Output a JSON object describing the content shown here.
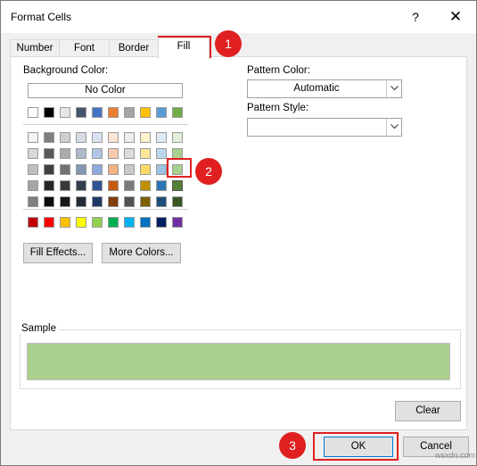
{
  "window": {
    "title": "Format Cells",
    "help_label": "?",
    "close_label": "✕"
  },
  "tabs": [
    {
      "label": "Number",
      "active": false
    },
    {
      "label": "Font",
      "active": false
    },
    {
      "label": "Border",
      "active": false
    },
    {
      "label": "Fill",
      "active": true
    }
  ],
  "background": {
    "label": "Background Color:",
    "no_color_label": "No Color",
    "top_row": [
      "#ffffff",
      "#000000",
      "#e7e6e6",
      "#44546a",
      "#4472c4",
      "#ed7d31",
      "#a5a5a5",
      "#ffc000",
      "#5b9bd5",
      "#70ad47"
    ],
    "theme_rows": [
      [
        "#f2f2f2",
        "#7f7f7f",
        "#d0cece",
        "#d6dce4",
        "#d9e2f3",
        "#fbe5d5",
        "#ededed",
        "#fff2cc",
        "#deebf6",
        "#e2efd9"
      ],
      [
        "#d8d8d8",
        "#595959",
        "#aeaaaa",
        "#adb9ca",
        "#b4c6e7",
        "#f7cbac",
        "#dbdbdb",
        "#fee599",
        "#bdd7ee",
        "#a9d08e"
      ],
      [
        "#bfbfbf",
        "#3f3f3f",
        "#757171",
        "#8496b0",
        "#8eaadb",
        "#f4b183",
        "#c9c9c9",
        "#ffd965",
        "#9cc3e5",
        "#a8d08d"
      ],
      [
        "#a5a5a5",
        "#262626",
        "#3a3838",
        "#323f4f",
        "#2f5496",
        "#c55a11",
        "#7b7b7b",
        "#bf9000",
        "#2e75b5",
        "#538135"
      ],
      [
        "#7f7f7f",
        "#0c0c0c",
        "#171616",
        "#222a35",
        "#1f3864",
        "#833c0b",
        "#525252",
        "#7f6000",
        "#1e4e79",
        "#375623"
      ]
    ],
    "standard_row": [
      "#c00000",
      "#ff0000",
      "#ffc000",
      "#ffff00",
      "#92d050",
      "#00b050",
      "#00b0f0",
      "#0070c0",
      "#002060",
      "#7030a0"
    ],
    "selected": {
      "row": 3,
      "col": 9
    }
  },
  "buttons": {
    "fill_effects": "Fill Effects...",
    "more_colors": "More Colors...",
    "clear": "Clear",
    "ok": "OK",
    "cancel": "Cancel"
  },
  "pattern": {
    "color_label": "Pattern Color:",
    "color_value": "Automatic",
    "style_label": "Pattern Style:",
    "style_value": ""
  },
  "sample": {
    "label": "Sample",
    "color": "#a9d08e"
  },
  "callouts": [
    "1",
    "2",
    "3"
  ],
  "accent_color": "#e02020",
  "watermark": "wsxdn.com"
}
